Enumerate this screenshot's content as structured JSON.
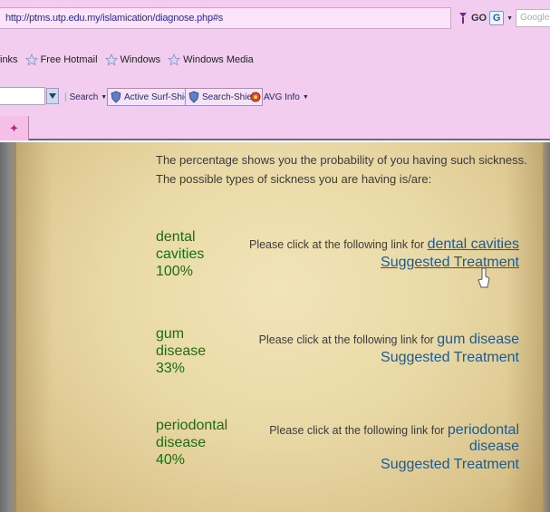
{
  "browser": {
    "url": "http://ptms.utp.edu.my/islamication/diagnose.php#s",
    "go_label": "GO",
    "google_placeholder": "Google",
    "links": [
      "inks",
      "Free Hotmail",
      "Windows",
      "Windows Media"
    ],
    "toolbar": {
      "search_label": "Search",
      "surf_shield": "Active Surf-Shield",
      "search_shield": "Search-Shield",
      "avg_info": "AVG Info"
    }
  },
  "page": {
    "intro": "The percentage shows you the probability of you having such sickness. The possible types of sickness you are having is/are:",
    "results": [
      {
        "disease_line1": "dental",
        "disease_line2": "cavities",
        "percent": "100%",
        "prompt": "Please click at the following link for ",
        "link_text": "dental cavities",
        "treatment": "Suggested Treatment"
      },
      {
        "disease_line1": "gum",
        "disease_line2": "disease",
        "percent": "33%",
        "prompt": "Please click at the following link for ",
        "link_text": "gum disease",
        "treatment": "Suggested Treatment"
      },
      {
        "disease_line1": "periodontal",
        "disease_line2": "disease",
        "percent": "40%",
        "prompt": "Please click at the following link for ",
        "link_text": "periodontal disease",
        "treatment": "Suggested Treatment"
      }
    ]
  },
  "colors": {
    "chrome": "#f3cdf0",
    "disease_text": "#1a6e12",
    "link": "#1f5a8c"
  }
}
